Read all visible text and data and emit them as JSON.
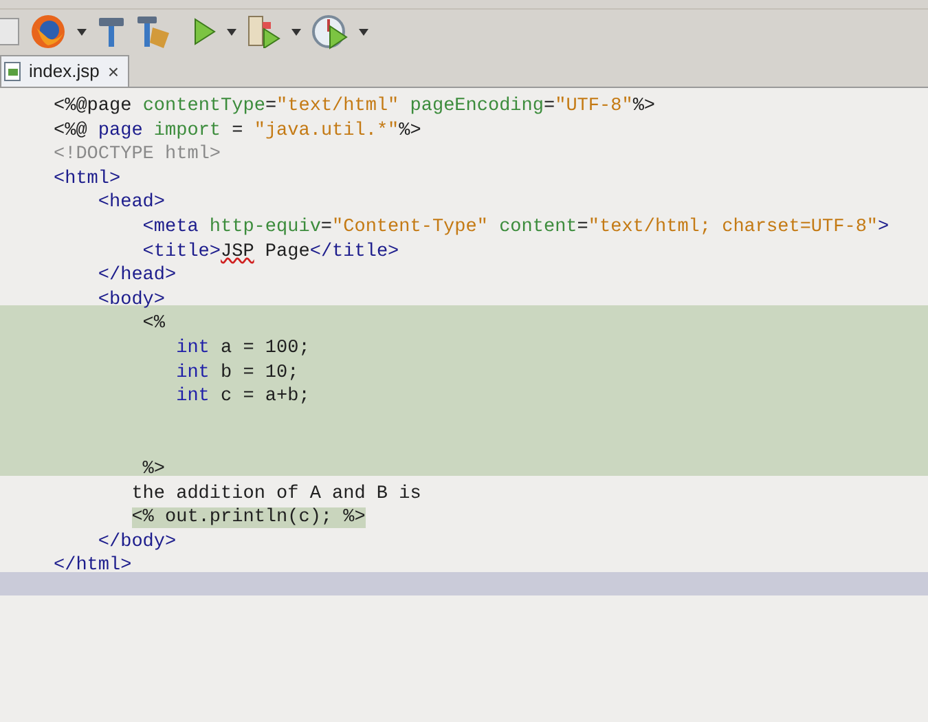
{
  "tabs": [
    {
      "label": "index.jsp",
      "close": "×",
      "selected": true
    }
  ],
  "lines": [
    {
      "scriptlet": false,
      "current": false,
      "segments": [
        {
          "kind": "directive",
          "text": "<%@page "
        },
        {
          "kind": "attr",
          "text": "contentType"
        },
        {
          "kind": "plain",
          "text": "="
        },
        {
          "kind": "value",
          "text": "\"text/html\" "
        },
        {
          "kind": "attr",
          "text": "pageEncoding"
        },
        {
          "kind": "plain",
          "text": "="
        },
        {
          "kind": "value",
          "text": "\"UTF-8\""
        },
        {
          "kind": "directive",
          "text": "%>"
        }
      ]
    },
    {
      "scriptlet": false,
      "current": false,
      "segments": [
        {
          "kind": "directive",
          "text": "<%@ "
        },
        {
          "kind": "tag",
          "text": "page "
        },
        {
          "kind": "attr",
          "text": "import"
        },
        {
          "kind": "plain",
          "text": " = "
        },
        {
          "kind": "value",
          "text": "\"java.util.*\""
        },
        {
          "kind": "directive",
          "text": "%>"
        }
      ]
    },
    {
      "scriptlet": false,
      "current": false,
      "segments": [
        {
          "kind": "doctype",
          "text": "<!DOCTYPE html>"
        }
      ]
    },
    {
      "scriptlet": false,
      "current": false,
      "segments": [
        {
          "kind": "tag",
          "text": "<html>"
        }
      ]
    },
    {
      "scriptlet": false,
      "current": false,
      "segments": [
        {
          "kind": "tag",
          "text": "    <head>"
        }
      ]
    },
    {
      "scriptlet": false,
      "current": false,
      "segments": [
        {
          "kind": "tag",
          "text": "        <meta "
        },
        {
          "kind": "attr",
          "text": "http-equiv"
        },
        {
          "kind": "plain",
          "text": "="
        },
        {
          "kind": "value",
          "text": "\"Content-Type\" "
        },
        {
          "kind": "attr",
          "text": "content"
        },
        {
          "kind": "plain",
          "text": "="
        },
        {
          "kind": "value",
          "text": "\"text/html; charset=UTF-8\""
        },
        {
          "kind": "tag",
          "text": ">"
        }
      ]
    },
    {
      "scriptlet": false,
      "current": false,
      "segments": [
        {
          "kind": "tag",
          "text": "        <title>"
        },
        {
          "kind": "misspelled",
          "text": "JSP"
        },
        {
          "kind": "plain",
          "text": " Page"
        },
        {
          "kind": "tag",
          "text": "</title>"
        }
      ]
    },
    {
      "scriptlet": false,
      "current": false,
      "segments": [
        {
          "kind": "tag",
          "text": "    </head>"
        }
      ]
    },
    {
      "scriptlet": false,
      "current": false,
      "segments": [
        {
          "kind": "tag",
          "text": "    <body>"
        }
      ]
    },
    {
      "scriptlet": true,
      "current": false,
      "segments": [
        {
          "kind": "directive",
          "text": "        <%"
        }
      ]
    },
    {
      "scriptlet": true,
      "current": false,
      "segments": [
        {
          "kind": "keyword",
          "text": "           int"
        },
        {
          "kind": "plain",
          "text": " a = 100;"
        }
      ]
    },
    {
      "scriptlet": true,
      "current": false,
      "segments": [
        {
          "kind": "keyword",
          "text": "           int"
        },
        {
          "kind": "plain",
          "text": " b = 10;"
        }
      ]
    },
    {
      "scriptlet": true,
      "current": false,
      "segments": [
        {
          "kind": "keyword",
          "text": "           int"
        },
        {
          "kind": "plain",
          "text": " c = a+b;"
        }
      ]
    },
    {
      "scriptlet": true,
      "current": false
    },
    {
      "scriptlet": true,
      "current": false
    },
    {
      "scriptlet": true,
      "current": false,
      "segments": [
        {
          "kind": "directive",
          "text": "        %>"
        }
      ]
    },
    {
      "scriptlet": false,
      "current": false,
      "segments": [
        {
          "kind": "plain",
          "text": "       the addition of A and B is"
        }
      ]
    },
    {
      "scriptlet": false,
      "current": false,
      "segments": [
        {
          "kind": "embedded",
          "text": "       <% out.println(c); %>"
        }
      ]
    },
    {
      "scriptlet": false,
      "current": false,
      "segments": [
        {
          "kind": "tag",
          "text": "    </body>"
        }
      ]
    },
    {
      "scriptlet": false,
      "current": false,
      "segments": [
        {
          "kind": "tag",
          "text": "</html>"
        }
      ]
    },
    {
      "scriptlet": false,
      "current": true
    }
  ]
}
